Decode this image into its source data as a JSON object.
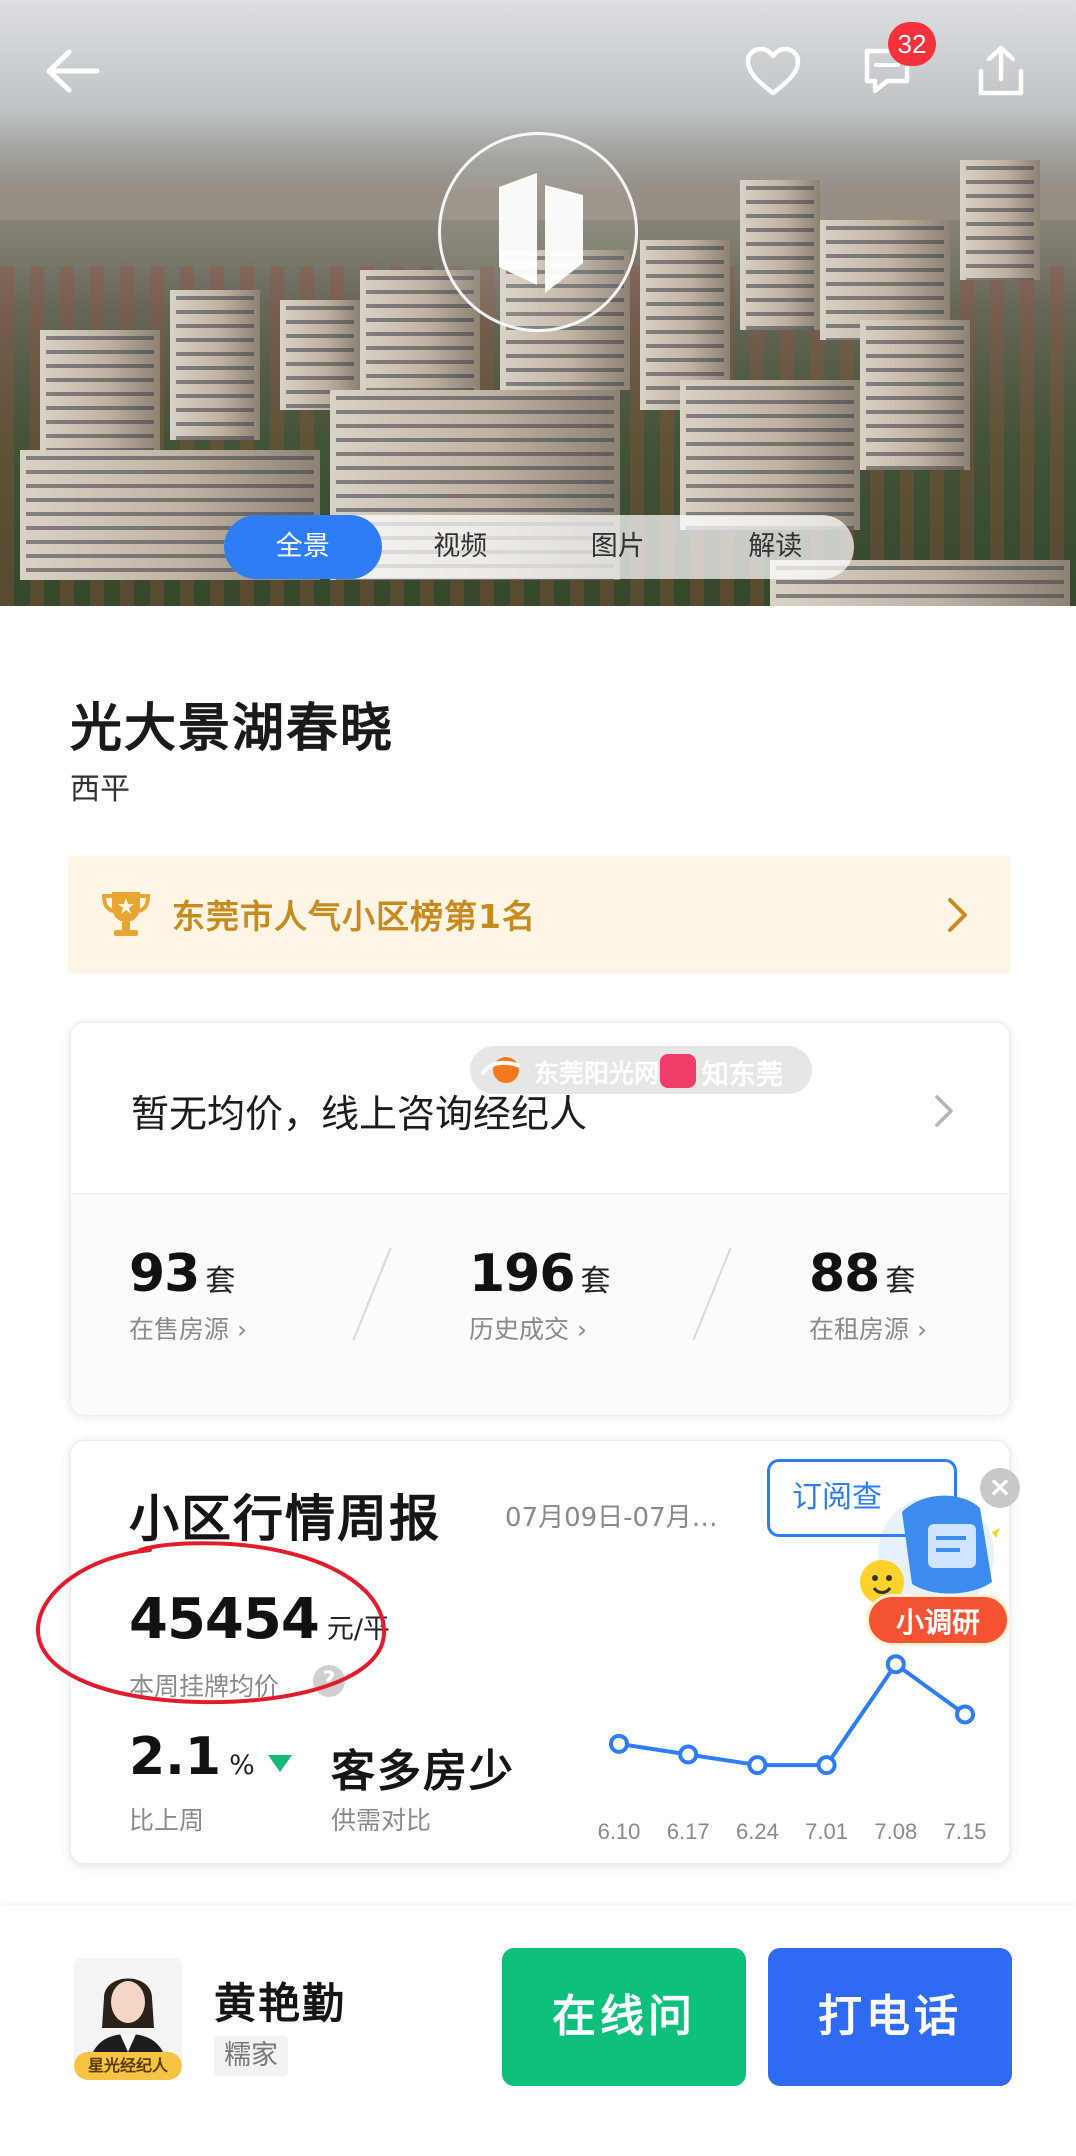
{
  "hero": {
    "badge_count": "32",
    "tabs": [
      {
        "label": "全景",
        "active": true
      },
      {
        "label": "视频",
        "active": false
      },
      {
        "label": "图片",
        "active": false
      },
      {
        "label": "解读",
        "active": false
      }
    ]
  },
  "community": {
    "name": "光大景湖春晓",
    "district": "西平"
  },
  "ranking": {
    "text": "东莞市人气小区榜第1名"
  },
  "price_card": {
    "headline": "暂无均价，线上咨询经纪人",
    "stats": [
      {
        "value": "93",
        "unit": "套",
        "label": "在售房源 ›"
      },
      {
        "value": "196",
        "unit": "套",
        "label": "历史成交 ›"
      },
      {
        "value": "88",
        "unit": "套",
        "label": "在租房源 ›"
      }
    ]
  },
  "watermark": {
    "left": "东莞阳光网",
    "right": "知东莞"
  },
  "weekly": {
    "title": "小区行情周报",
    "date_range": "07月09日-07月…",
    "subscribe_label": "订阅查",
    "price_value": "45454",
    "price_unit": "元/平",
    "price_label": "本周挂牌均价",
    "help_mark": "?",
    "change_value": "2.1",
    "change_unit": "%",
    "change_label": "比上周",
    "supply_demand": "客多房少",
    "supply_demand_label": "供需对比",
    "survey_label": "小调研",
    "survey_close": "×"
  },
  "chart_data": {
    "type": "line",
    "x": [
      "6.10",
      "6.17",
      "6.24",
      "7.01",
      "7.08",
      "7.15"
    ],
    "series": [
      {
        "values": [
          44900,
          44700,
          44500,
          44500,
          46400,
          45454
        ]
      }
    ],
    "ylim": [
      44200,
      46800
    ],
    "color": "#2f7df6"
  },
  "agent": {
    "name": "黄艳勤",
    "company": "糯家",
    "tag": "星光经纪人"
  },
  "actions": {
    "online_label": "在线问",
    "call_label": "打电话"
  },
  "colors": {
    "accent": "#2f7df6",
    "online": "#0fbf7c",
    "call": "#2f6bf2",
    "badge": "#f5323c",
    "rank_text": "#c78a1f"
  }
}
